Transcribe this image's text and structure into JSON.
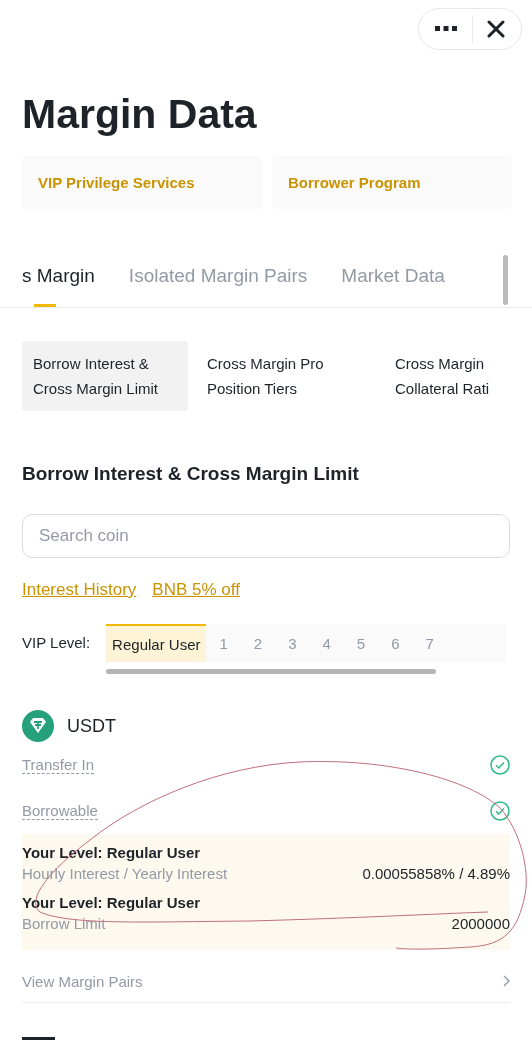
{
  "title": "Margin Data",
  "cards": [
    "VIP Privilege Services",
    "Borrower Program"
  ],
  "tabs": [
    {
      "label": "s Margin",
      "selected": true
    },
    {
      "label": "Isolated Margin Pairs",
      "selected": false
    },
    {
      "label": "Market Data",
      "selected": false
    }
  ],
  "subtabs": [
    {
      "lines": [
        "Borrow Interest &",
        "Cross Margin Limit"
      ],
      "selected": true
    },
    {
      "lines": [
        "Cross Margin Pro",
        "Position Tiers"
      ],
      "selected": false
    },
    {
      "lines": [
        "Cross Margin",
        "Collateral Rati"
      ],
      "selected": false
    }
  ],
  "section_title": "Borrow Interest & Cross Margin Limit",
  "search": {
    "placeholder": "Search coin"
  },
  "links": [
    "Interest History",
    "BNB 5% off"
  ],
  "vip": {
    "label": "VIP Level:",
    "levels": [
      {
        "label": "Regular User",
        "selected": true
      },
      {
        "label": "1",
        "selected": false
      },
      {
        "label": "2",
        "selected": false
      },
      {
        "label": "3",
        "selected": false
      },
      {
        "label": "4",
        "selected": false
      },
      {
        "label": "5",
        "selected": false
      },
      {
        "label": "6",
        "selected": false
      },
      {
        "label": "7",
        "selected": false
      }
    ]
  },
  "coin": {
    "name": "USDT",
    "features": [
      {
        "label": "Transfer In",
        "checked": true
      },
      {
        "label": "Borrowable",
        "checked": true
      }
    ],
    "details": [
      {
        "level": "Your Level: Regular User",
        "label": "Hourly Interest / Yearly Interest",
        "value": "0.00055858% / 4.89%"
      },
      {
        "level": "Your Level: Regular User",
        "label": "Borrow Limit",
        "value": "2000000"
      }
    ],
    "link": "View Margin Pairs"
  },
  "annotation": {
    "kind": "scribble"
  }
}
